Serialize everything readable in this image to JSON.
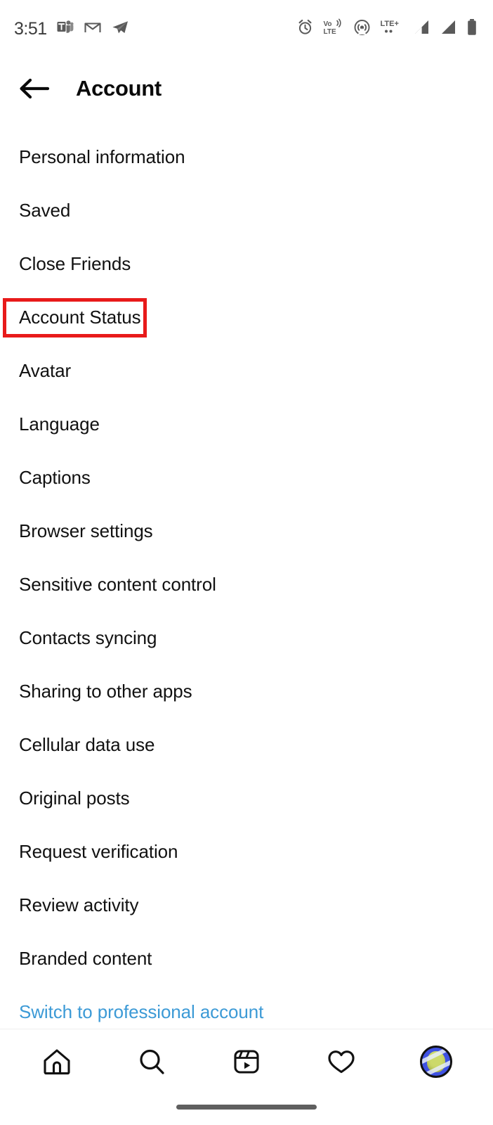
{
  "status_bar": {
    "time": "3:51",
    "left_icons": [
      {
        "name": "teams-icon",
        "label": "Microsoft Teams"
      },
      {
        "name": "gmail-icon",
        "label": "Gmail"
      },
      {
        "name": "telegram-icon",
        "label": "Telegram"
      }
    ],
    "right_icons": [
      {
        "name": "alarm-icon",
        "label": "Alarm"
      },
      {
        "name": "volte-icon",
        "label": "VoLTE"
      },
      {
        "name": "hotspot-icon",
        "label": "Hotspot"
      },
      {
        "name": "lte-plus-icon",
        "label": "LTE+"
      },
      {
        "name": "signal-sim1-icon",
        "label": "Signal SIM 1"
      },
      {
        "name": "signal-sim2-icon",
        "label": "Signal SIM 2"
      },
      {
        "name": "battery-icon",
        "label": "Battery"
      }
    ]
  },
  "header": {
    "title": "Account",
    "back_label": "Back"
  },
  "settings": {
    "items": [
      {
        "label": "Personal information",
        "highlighted": false,
        "link": false
      },
      {
        "label": "Saved",
        "highlighted": false,
        "link": false
      },
      {
        "label": "Close Friends",
        "highlighted": false,
        "link": false
      },
      {
        "label": "Account Status",
        "highlighted": true,
        "link": false
      },
      {
        "label": "Avatar",
        "highlighted": false,
        "link": false
      },
      {
        "label": "Language",
        "highlighted": false,
        "link": false
      },
      {
        "label": "Captions",
        "highlighted": false,
        "link": false
      },
      {
        "label": "Browser settings",
        "highlighted": false,
        "link": false
      },
      {
        "label": "Sensitive content control",
        "highlighted": false,
        "link": false
      },
      {
        "label": "Contacts syncing",
        "highlighted": false,
        "link": false
      },
      {
        "label": "Sharing to other apps",
        "highlighted": false,
        "link": false
      },
      {
        "label": "Cellular data use",
        "highlighted": false,
        "link": false
      },
      {
        "label": "Original posts",
        "highlighted": false,
        "link": false
      },
      {
        "label": "Request verification",
        "highlighted": false,
        "link": false
      },
      {
        "label": "Review activity",
        "highlighted": false,
        "link": false
      },
      {
        "label": "Branded content",
        "highlighted": false,
        "link": false
      },
      {
        "label": "Switch to professional account",
        "highlighted": false,
        "link": true
      }
    ]
  },
  "bottom_nav": {
    "items": [
      {
        "name": "nav-home",
        "label": "Home",
        "icon": "home-icon"
      },
      {
        "name": "nav-search",
        "label": "Search",
        "icon": "search-icon"
      },
      {
        "name": "nav-reels",
        "label": "Reels",
        "icon": "reels-icon"
      },
      {
        "name": "nav-activity",
        "label": "Activity",
        "icon": "heart-icon"
      },
      {
        "name": "nav-profile",
        "label": "Profile",
        "icon": "avatar-icon"
      }
    ]
  },
  "colors": {
    "highlight_border": "#e81a1a",
    "link_text": "#3c9ad6",
    "primary_text": "#111111",
    "background": "#ffffff",
    "avatar_ring": "#3f52e3"
  }
}
